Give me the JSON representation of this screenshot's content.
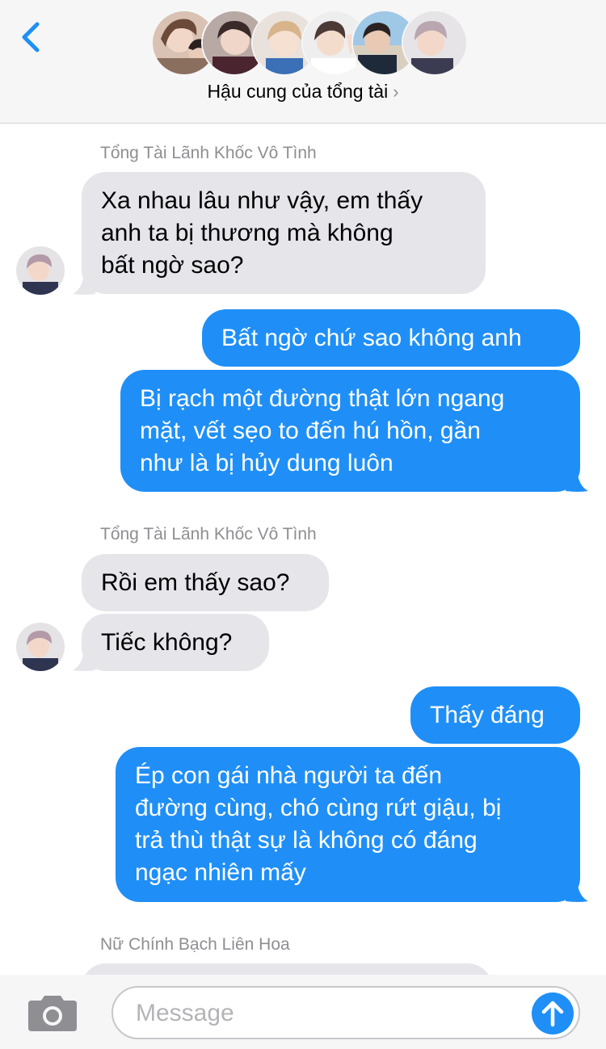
{
  "header": {
    "title": "Hậu cung của tổng tài",
    "chevron": "›",
    "back_icon": "chevron-left-icon",
    "avatar_count": 6
  },
  "colors": {
    "outgoing": "#1f8ff7",
    "incoming": "#e5e5ea",
    "accent": "#1f8ff7"
  },
  "messages": [
    {
      "sender": "Tổng Tài Lãnh Khốc Vô Tình"
    },
    {
      "text_lines": [
        "Xa nhau lâu như vậy, em thấy",
        "anh ta bị thương mà không",
        "bất ngờ sao?"
      ]
    },
    {
      "text": "Bất ngờ chứ sao không anh"
    },
    {
      "text_lines": [
        "Bị rạch một đường thật lớn ngang",
        "mặt, vết sẹo to đến hú hồn, gần",
        "như là bị hủy dung luôn"
      ]
    },
    {
      "sender": "Tổng Tài Lãnh Khốc Vô Tình"
    },
    {
      "text": "Rồi em thấy sao?"
    },
    {
      "text": "Tiếc không?"
    },
    {
      "text": "Thấy đáng"
    },
    {
      "text_lines": [
        "Ép con gái nhà người ta đến",
        "đường cùng, chó cùng rứt giậu, bị",
        "trả thù thật sự là không có đáng",
        "ngạc nhiên mấy"
      ]
    },
    {
      "sender": "Nữ Chính Bạch Liên Hoa"
    }
  ],
  "input": {
    "placeholder": "Message",
    "camera_icon": "camera-icon",
    "send_icon": "arrow-up-icon"
  }
}
